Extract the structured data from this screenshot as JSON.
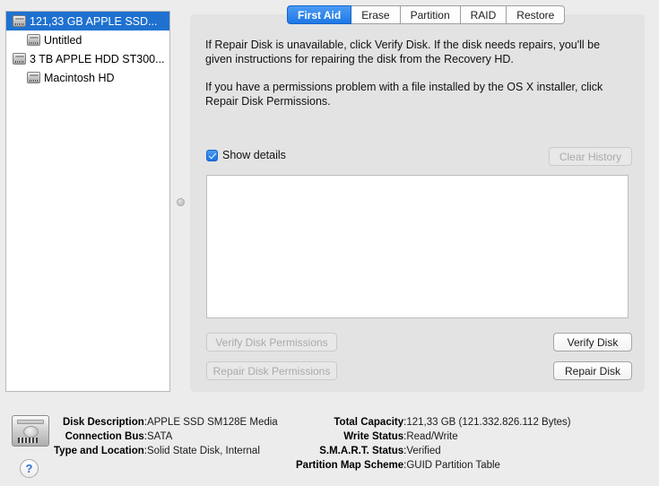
{
  "sidebar": {
    "items": [
      {
        "label": "121,33 GB APPLE SSD...",
        "type": "drive",
        "selected": true,
        "icon": "hard-drive-icon"
      },
      {
        "label": "Untitled",
        "type": "volume",
        "selected": false,
        "icon": "hard-drive-icon"
      },
      {
        "label": "3 TB APPLE HDD ST300...",
        "type": "drive",
        "selected": false,
        "icon": "hard-drive-icon"
      },
      {
        "label": "Macintosh HD",
        "type": "volume",
        "selected": false,
        "icon": "hard-drive-icon"
      }
    ]
  },
  "tabs": [
    {
      "label": "First Aid",
      "active": true
    },
    {
      "label": "Erase",
      "active": false
    },
    {
      "label": "Partition",
      "active": false
    },
    {
      "label": "RAID",
      "active": false
    },
    {
      "label": "Restore",
      "active": false
    }
  ],
  "main": {
    "paragraph1": "If Repair Disk is unavailable, click Verify Disk. If the disk needs repairs, you'll be given instructions for repairing the disk from the Recovery HD.",
    "paragraph2": "If you have a permissions problem with a file installed by the OS X installer, click Repair Disk Permissions.",
    "show_details_label": "Show details",
    "show_details_checked": true,
    "clear_history_label": "Clear History",
    "log_text": "",
    "verify_disk_permissions_label": "Verify Disk Permissions",
    "repair_disk_permissions_label": "Repair Disk Permissions",
    "verify_disk_label": "Verify Disk",
    "repair_disk_label": "Repair Disk"
  },
  "info": {
    "left": [
      {
        "key": "Disk Description",
        "value": "APPLE SSD SM128E Media"
      },
      {
        "key": "Connection Bus",
        "value": "SATA"
      },
      {
        "key": "Type and Location",
        "value": "Solid State Disk, Internal"
      }
    ],
    "right": [
      {
        "key": "Total Capacity",
        "value": "121,33 GB (121.332.826.112 Bytes)"
      },
      {
        "key": "Write Status",
        "value": "Read/Write"
      },
      {
        "key": "S.M.A.R.T. Status",
        "value": "Verified"
      },
      {
        "key": "Partition Map Scheme",
        "value": "GUID Partition Table"
      }
    ]
  },
  "help": {
    "label": "?"
  },
  "colors": {
    "selection_blue": "#1f71d0",
    "accent_blue": "#1b74e4",
    "window_background": "#ececec",
    "panel_background": "#e3e3e3"
  }
}
